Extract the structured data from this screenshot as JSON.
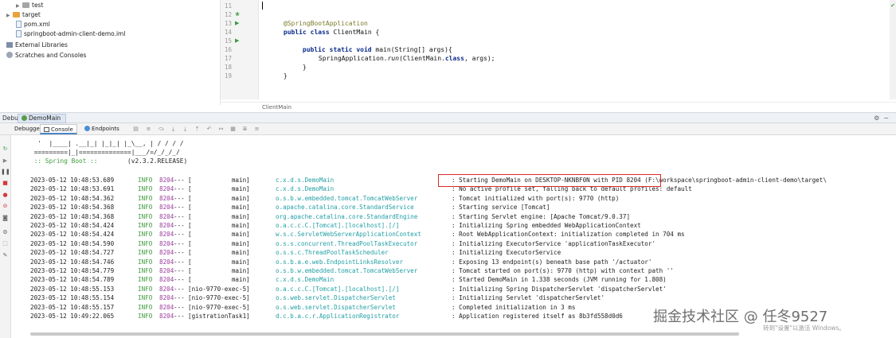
{
  "project_tree": {
    "items": [
      {
        "label": "test",
        "icon": "folder-icon"
      },
      {
        "label": "target",
        "icon": "folder-orange-icon"
      },
      {
        "label": "pom.xml",
        "icon": "maven-file-icon"
      },
      {
        "label": "springboot-admin-client-demo.iml",
        "icon": "module-file-icon"
      },
      {
        "label": "External Libraries",
        "icon": "library-icon"
      },
      {
        "label": "Scratches and Consoles",
        "icon": "scratch-icon"
      }
    ]
  },
  "editor": {
    "line_numbers": [
      "11",
      "12",
      "13",
      "14",
      "15",
      "16",
      "17",
      "18",
      "19"
    ],
    "lines": {
      "annotation": "@SpringBootApplication",
      "class_kw": "public class ",
      "class_name": "ClientMain {",
      "main_kw": "public static void ",
      "main_sig": "main(String[] args){",
      "run_prefix": "SpringApplication.",
      "run_method": "run",
      "run_args_a": "(ClientMain.",
      "run_class_kw": "class",
      "run_args_b": ", args);",
      "close_inner": "}",
      "close_outer": "}"
    },
    "breadcrumb": "ClientMain"
  },
  "debug": {
    "title": "Debug:",
    "run_config": "DemoMain",
    "tabs": {
      "debugger": "Debugger",
      "console": "Console",
      "endpoints": "Endpoints"
    }
  },
  "console": {
    "banner": [
      "  '  |____| .__|_| |_|_| |_\\__, | / / / /",
      " =========|_|==============|___/=/_/_/_/"
    ],
    "banner_label": " :: Spring Boot :: ",
    "banner_version": "       (v2.3.2.RELEASE)",
    "logs": [
      {
        "time": "2023-05-12 10:48:53.689",
        "level": "INFO",
        "pid": "8204",
        "dash": "---",
        "thread": "[           main]",
        "logger": "c.x.d.s.DemoMain",
        "msg": ": Starting DemoMain on DESKTOP-NKNBF0N with PID 8204 (F:\\workspace\\springboot-admin-client-demo\\target\\"
      },
      {
        "time": "2023-05-12 10:48:53.691",
        "level": "INFO",
        "pid": "8204",
        "dash": "---",
        "thread": "[           main]",
        "logger": "c.x.d.s.DemoMain",
        "msg": ": No active profile set, falling back to default profiles: default"
      },
      {
        "time": "2023-05-12 10:48:54.362",
        "level": "INFO",
        "pid": "8204",
        "dash": "---",
        "thread": "[           main]",
        "logger": "o.s.b.w.embedded.tomcat.TomcatWebServer",
        "msg": ": Tomcat initialized with port(s): 9770 (http)"
      },
      {
        "time": "2023-05-12 10:48:54.368",
        "level": "INFO",
        "pid": "8204",
        "dash": "---",
        "thread": "[           main]",
        "logger": "o.apache.catalina.core.StandardService",
        "msg": ": Starting service [Tomcat]"
      },
      {
        "time": "2023-05-12 10:48:54.368",
        "level": "INFO",
        "pid": "8204",
        "dash": "---",
        "thread": "[           main]",
        "logger": "org.apache.catalina.core.StandardEngine",
        "msg": ": Starting Servlet engine: [Apache Tomcat/9.0.37]"
      },
      {
        "time": "2023-05-12 10:48:54.424",
        "level": "INFO",
        "pid": "8204",
        "dash": "---",
        "thread": "[           main]",
        "logger": "o.a.c.c.C.[Tomcat].[localhost].[/]",
        "msg": ": Initializing Spring embedded WebApplicationContext"
      },
      {
        "time": "2023-05-12 10:48:54.424",
        "level": "INFO",
        "pid": "8204",
        "dash": "---",
        "thread": "[           main]",
        "logger": "w.s.c.ServletWebServerApplicationContext",
        "msg": ": Root WebApplicationContext: initialization completed in 704 ms"
      },
      {
        "time": "2023-05-12 10:48:54.590",
        "level": "INFO",
        "pid": "8204",
        "dash": "---",
        "thread": "[           main]",
        "logger": "o.s.s.concurrent.ThreadPoolTaskExecutor",
        "msg": ": Initializing ExecutorService 'applicationTaskExecutor'"
      },
      {
        "time": "2023-05-12 10:48:54.727",
        "level": "INFO",
        "pid": "8204",
        "dash": "---",
        "thread": "[           main]",
        "logger": "o.s.s.c.ThreadPoolTaskScheduler",
        "msg": ": Initializing ExecutorService"
      },
      {
        "time": "2023-05-12 10:48:54.746",
        "level": "INFO",
        "pid": "8204",
        "dash": "---",
        "thread": "[           main]",
        "logger": "o.s.b.a.e.web.EndpointLinksResolver",
        "msg": ": Exposing 13 endpoint(s) beneath base path '/actuator'"
      },
      {
        "time": "2023-05-12 10:48:54.779",
        "level": "INFO",
        "pid": "8204",
        "dash": "---",
        "thread": "[           main]",
        "logger": "o.s.b.w.embedded.tomcat.TomcatWebServer",
        "msg": ": Tomcat started on port(s): 9770 (http) with context path ''"
      },
      {
        "time": "2023-05-12 10:48:54.789",
        "level": "INFO",
        "pid": "8204",
        "dash": "---",
        "thread": "[           main]",
        "logger": "c.x.d.s.DemoMain",
        "msg": ": Started DemoMain in 1.338 seconds (JVM running for 1.808)"
      },
      {
        "time": "2023-05-12 10:48:55.153",
        "level": "INFO",
        "pid": "8204",
        "dash": "---",
        "thread": "[nio-9770-exec-5]",
        "logger": "o.a.c.c.C.[Tomcat].[localhost].[/]",
        "msg": ": Initializing Spring DispatcherServlet 'dispatcherServlet'"
      },
      {
        "time": "2023-05-12 10:48:55.154",
        "level": "INFO",
        "pid": "8204",
        "dash": "---",
        "thread": "[nio-9770-exec-5]",
        "logger": "o.s.web.servlet.DispatcherServlet",
        "msg": ": Initializing Servlet 'dispatcherServlet'"
      },
      {
        "time": "2023-05-12 10:48:55.157",
        "level": "INFO",
        "pid": "8204",
        "dash": "---",
        "thread": "[nio-9770-exec-5]",
        "logger": "o.s.web.servlet.DispatcherServlet",
        "msg": ": Completed initialization in 3 ms"
      },
      {
        "time": "2023-05-12 10:49:22.065",
        "level": "INFO",
        "pid": "8204",
        "dash": "---",
        "thread": "[gistrationTask1]",
        "logger": "d.c.b.a.c.r.ApplicationRegistrator",
        "msg": ": Application registered itself as 8b3fd558d0d6"
      }
    ]
  },
  "watermark": "掘金技术社区 @ 任冬9527",
  "activate_text": "转到\"设置\"以激活 Windows。",
  "colors": {
    "log_info": "#3c9a3c",
    "log_pid": "#9b3b9b",
    "log_logger": "#23a0a6",
    "highlight": "#e02828"
  }
}
